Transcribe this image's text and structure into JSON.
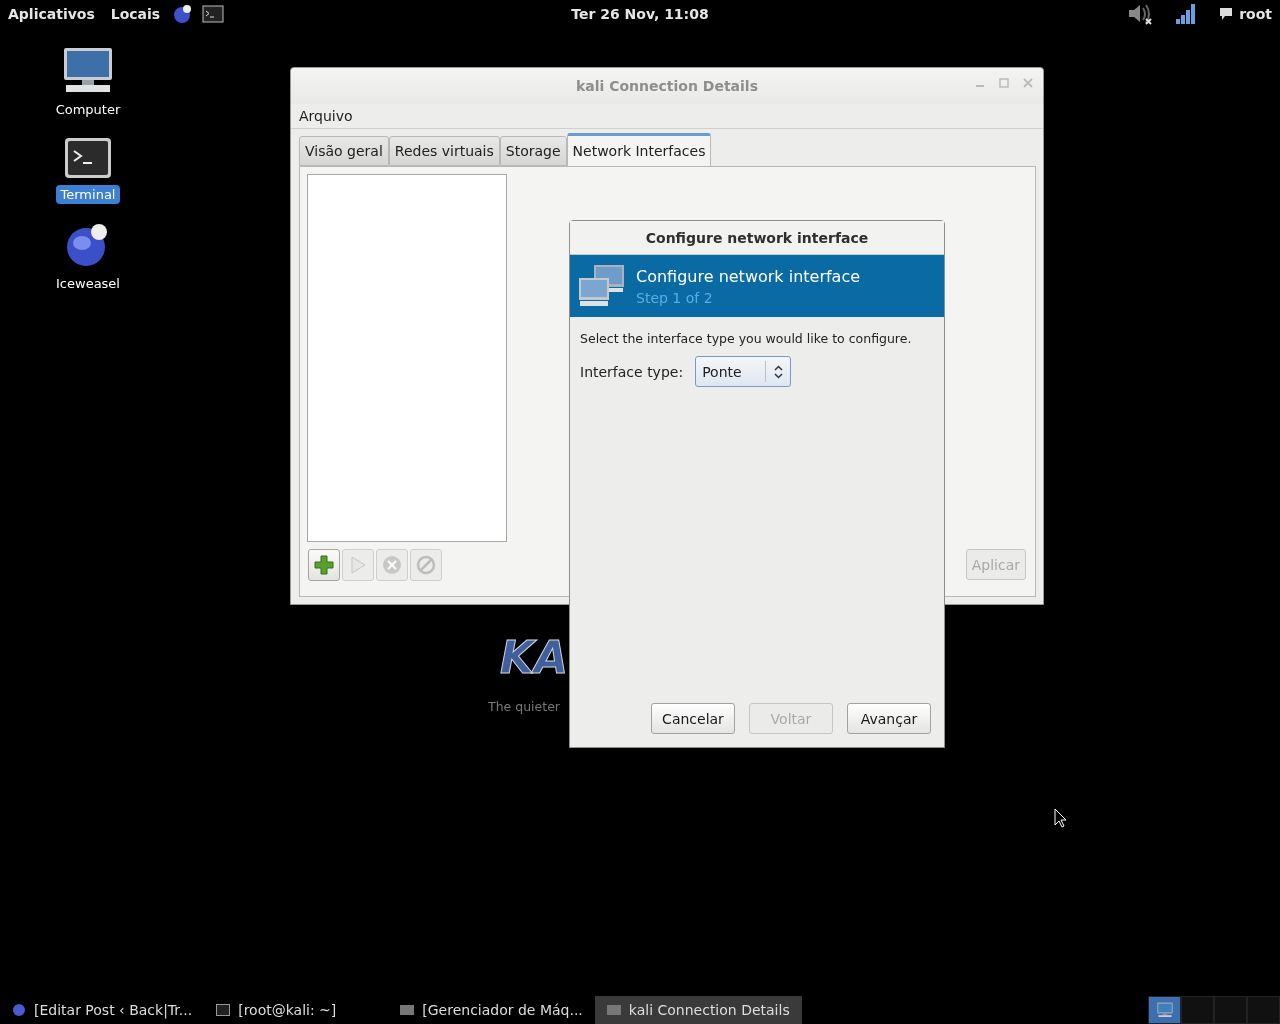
{
  "top_panel": {
    "menus": [
      {
        "label": "Aplicativos"
      },
      {
        "label": "Locais"
      }
    ],
    "clock": "Ter 26 Nov, 11:08",
    "user": "root"
  },
  "desktop_icons": [
    {
      "label": "Computer",
      "kind": "computer",
      "selected": false
    },
    {
      "label": "Terminal",
      "kind": "terminal",
      "selected": true
    },
    {
      "label": "Iceweasel",
      "kind": "browser",
      "selected": false
    }
  ],
  "wallpaper": {
    "logo": "KA",
    "tagline": "The quieter"
  },
  "window": {
    "title": "kali Connection Details",
    "menu": [
      "Arquivo"
    ],
    "tabs": [
      {
        "label": "Visão geral",
        "selected": false
      },
      {
        "label": "Redes virtuais",
        "selected": false
      },
      {
        "label": "Storage",
        "selected": false
      },
      {
        "label": "Network Interfaces",
        "selected": true
      }
    ],
    "toolbar_buttons": [
      {
        "kind": "add",
        "disabled": false
      },
      {
        "kind": "start",
        "disabled": true
      },
      {
        "kind": "stop",
        "disabled": true
      },
      {
        "kind": "delete",
        "disabled": true
      }
    ],
    "apply_button": {
      "label": "Aplicar",
      "disabled": true
    }
  },
  "dialog": {
    "title": "Configure network interface",
    "header_title": "Configure network interface",
    "header_step": "Step 1 of 2",
    "prompt": "Select the interface type you would like to configure.",
    "field_label": "Interface type:",
    "select_value": "Ponte",
    "buttons": [
      {
        "label": "Cancelar",
        "disabled": false
      },
      {
        "label": "Voltar",
        "disabled": true
      },
      {
        "label": "Avançar",
        "disabled": false
      }
    ]
  },
  "taskbar": {
    "items": [
      {
        "label": "[Editar Post ‹ Back|Tr...",
        "kind": "browser",
        "selected": false
      },
      {
        "label": "[root@kali: ~]",
        "kind": "terminal",
        "selected": false
      },
      {
        "label": "[Gerenciador de Máq...",
        "kind": "manager",
        "selected": false
      },
      {
        "label": "kali Connection Details",
        "kind": "manager",
        "selected": true
      }
    ],
    "workspaces": [
      {
        "selected": true
      },
      {
        "selected": false
      },
      {
        "selected": false
      },
      {
        "selected": false
      }
    ]
  }
}
